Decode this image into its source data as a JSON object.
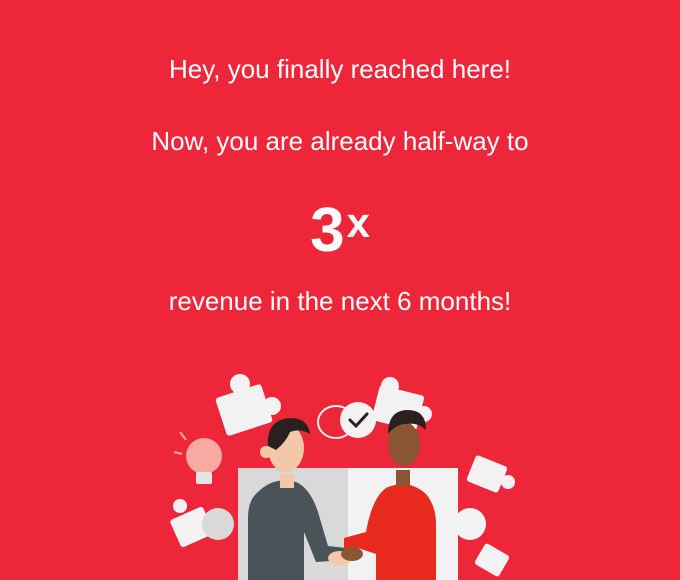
{
  "message": {
    "greeting": "Hey, you finally reached here!",
    "progress": "Now, you are already half-way to",
    "multiplier_number": "3",
    "multiplier_suffix": "x",
    "goal": "revenue in the next 6 months!"
  },
  "illustration": {
    "subject": "handshake-puzzle",
    "colors": {
      "background": "#ED263A",
      "puzzle": "#F2F2F2",
      "puzzle_shadow": "#D9D9D9",
      "suit_left": "#4A5358",
      "suit_right": "#E8291E",
      "skin_left": "#F2C8A8",
      "skin_right": "#8A5533",
      "hair": "#2B2020",
      "bulb": "#F7A9A2"
    }
  }
}
